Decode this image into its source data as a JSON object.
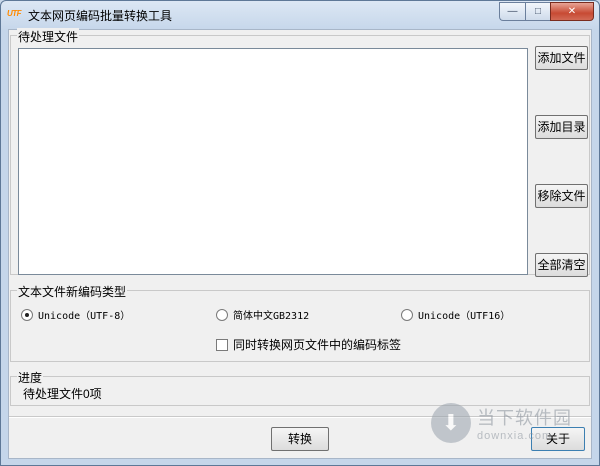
{
  "window": {
    "title": "文本网页编码批量转换工具",
    "icon_text": "UTF",
    "controls": {
      "minimize": "—",
      "maximize": "□",
      "close": "✕"
    }
  },
  "files_group": {
    "label": "待处理文件",
    "buttons": {
      "add_file": "添加文件",
      "add_dir": "添加目录",
      "remove_file": "移除文件",
      "clear_all": "全部清空"
    }
  },
  "encoding_group": {
    "label": "文本文件新编码类型",
    "options": [
      {
        "label": "Unicode（UTF-8）",
        "selected": true
      },
      {
        "label": "简体中文GB2312",
        "selected": false
      },
      {
        "label": "Unicode（UTF16）",
        "selected": false
      }
    ],
    "checkbox_label": "同时转换网页文件中的编码标签",
    "checkbox_checked": false
  },
  "progress_group": {
    "label": "进度",
    "status": "待处理文件0项"
  },
  "footer": {
    "convert_label": "转换",
    "about_label": "关于"
  },
  "watermark": {
    "icon": "download-arrow-icon",
    "big": "当下软件园",
    "small": "downxia.com"
  }
}
